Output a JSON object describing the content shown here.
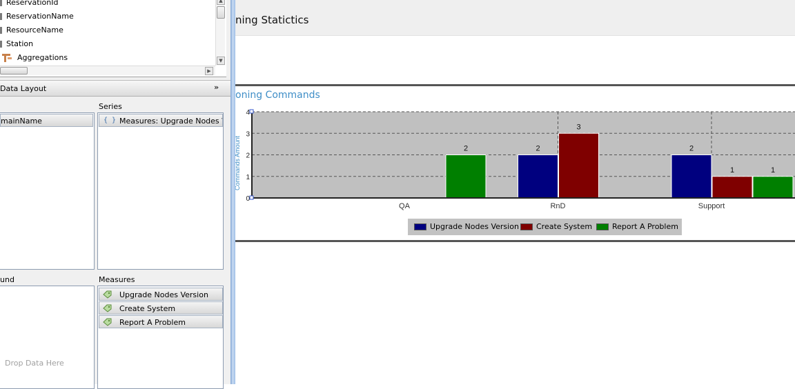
{
  "field_list": {
    "items": [
      {
        "label": "ReservationId"
      },
      {
        "label": "ReservationName"
      },
      {
        "label": "ResourceName"
      },
      {
        "label": "Station"
      },
      {
        "label": "Aggregations"
      }
    ]
  },
  "data_layout": {
    "title": "Data Layout",
    "collapse_glyph": "»",
    "rows_item": "mainName",
    "series_label": "Series",
    "series_item": "Measures: Upgrade Nodes Version",
    "background_label": "und",
    "measures_label": "Measures",
    "measures": [
      {
        "label": "Upgrade Nodes Version"
      },
      {
        "label": "Create System"
      },
      {
        "label": "Report A Problem"
      }
    ],
    "drop_text": "Drop Data Here"
  },
  "report": {
    "title": "ning Statictics",
    "chart_title": "oning Commands",
    "y_axis_label": "Commands Amount"
  },
  "chart_data": {
    "type": "bar",
    "title": "oning Commands",
    "categories": [
      "QA",
      "RnD",
      "Support"
    ],
    "series": [
      {
        "name": "Upgrade Nodes Version",
        "color": "#00007f",
        "values": [
          null,
          2,
          2
        ]
      },
      {
        "name": "Create System",
        "color": "#7f0000",
        "values": [
          null,
          3,
          1
        ]
      },
      {
        "name": "Report A Problem",
        "color": "#007f00",
        "values": [
          2,
          null,
          1
        ]
      }
    ],
    "ylabel": "Commands Amount",
    "ylim": [
      0,
      4
    ],
    "yticks": [
      0,
      1,
      2,
      3,
      4
    ],
    "grid": true,
    "legend": "bottom"
  }
}
